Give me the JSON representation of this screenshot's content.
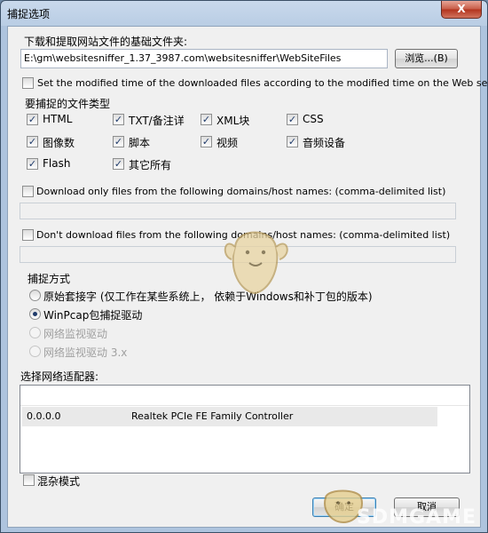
{
  "window": {
    "title": "捕捉选项",
    "close_glyph": "X"
  },
  "base_folder": {
    "label": "下载和提取网站文件的基础文件夹:",
    "value": "E:\\gm\\websitesniffer_1.37_3987.com\\websitesniffer\\WebSiteFiles",
    "browse_label": "浏览...(B)"
  },
  "set_modified_time": {
    "label": "Set the modified time of the downloaded files according to the modified time on the Web server",
    "checked": false
  },
  "file_types": {
    "label": "要捕捉的文件类型",
    "items": [
      {
        "label": "HTML",
        "checked": true
      },
      {
        "label": "TXT/备注详",
        "checked": true
      },
      {
        "label": "XML块",
        "checked": true
      },
      {
        "label": "CSS",
        "checked": true
      },
      {
        "label": "图像数",
        "checked": true
      },
      {
        "label": "脚本",
        "checked": true
      },
      {
        "label": "视频",
        "checked": true
      },
      {
        "label": "音频设备",
        "checked": true
      },
      {
        "label": "Flash",
        "checked": true
      },
      {
        "label": "其它所有",
        "checked": true
      }
    ]
  },
  "download_only": {
    "label": "Download only files from the following domains/host names: (comma-delimited list)",
    "checked": false,
    "value": ""
  },
  "dont_download": {
    "label": "Don't download files from the following domains/host names: (comma-delimited list)",
    "checked": false,
    "value": ""
  },
  "capture_method": {
    "label": "捕捉方式",
    "options": [
      {
        "label": "原始套接字 (仅工作在某些系统上， 依赖于Windows和补丁包的版本)",
        "selected": false,
        "enabled": true
      },
      {
        "label": "WinPcap包捕捉驱动",
        "selected": true,
        "enabled": true
      },
      {
        "label": "网络监视驱动",
        "selected": false,
        "enabled": false
      },
      {
        "label": "网络监视驱动 3.x",
        "selected": false,
        "enabled": false
      }
    ]
  },
  "adapters": {
    "label": "选择网络适配器:",
    "rows": [
      {
        "ip": "0.0.0.0",
        "name": "Realtek PCIe FE Family Controller"
      }
    ]
  },
  "promiscuous": {
    "label": "混杂模式",
    "checked": false
  },
  "buttons": {
    "ok": "确定",
    "cancel": "取消"
  },
  "watermark": {
    "text": "SDMGAME",
    "mascot": "mascot-icon"
  },
  "colors": {
    "title_bar": "#b9cde4",
    "close_button": "#c75a45",
    "dialog_bg": "#f0f0f0",
    "check_color": "#1e3a6a"
  }
}
